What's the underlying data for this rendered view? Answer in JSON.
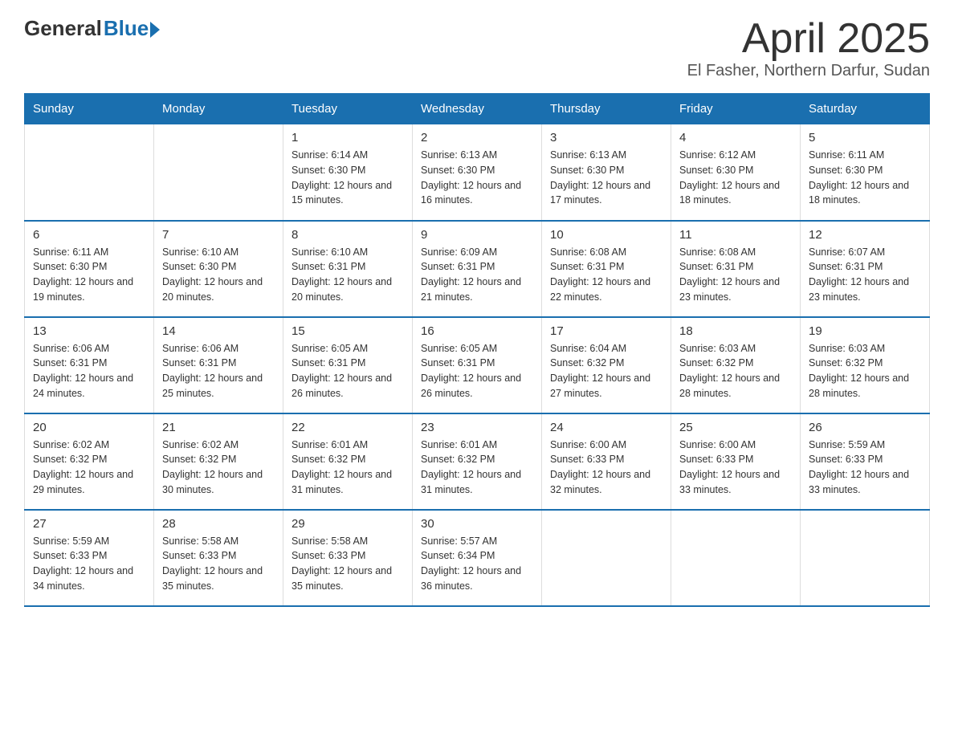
{
  "logo": {
    "general": "General",
    "blue": "Blue"
  },
  "title": "April 2025",
  "subtitle": "El Fasher, Northern Darfur, Sudan",
  "days_of_week": [
    "Sunday",
    "Monday",
    "Tuesday",
    "Wednesday",
    "Thursday",
    "Friday",
    "Saturday"
  ],
  "weeks": [
    [
      {
        "day": "",
        "sunrise": "",
        "sunset": "",
        "daylight": ""
      },
      {
        "day": "",
        "sunrise": "",
        "sunset": "",
        "daylight": ""
      },
      {
        "day": "1",
        "sunrise": "Sunrise: 6:14 AM",
        "sunset": "Sunset: 6:30 PM",
        "daylight": "Daylight: 12 hours and 15 minutes."
      },
      {
        "day": "2",
        "sunrise": "Sunrise: 6:13 AM",
        "sunset": "Sunset: 6:30 PM",
        "daylight": "Daylight: 12 hours and 16 minutes."
      },
      {
        "day": "3",
        "sunrise": "Sunrise: 6:13 AM",
        "sunset": "Sunset: 6:30 PM",
        "daylight": "Daylight: 12 hours and 17 minutes."
      },
      {
        "day": "4",
        "sunrise": "Sunrise: 6:12 AM",
        "sunset": "Sunset: 6:30 PM",
        "daylight": "Daylight: 12 hours and 18 minutes."
      },
      {
        "day": "5",
        "sunrise": "Sunrise: 6:11 AM",
        "sunset": "Sunset: 6:30 PM",
        "daylight": "Daylight: 12 hours and 18 minutes."
      }
    ],
    [
      {
        "day": "6",
        "sunrise": "Sunrise: 6:11 AM",
        "sunset": "Sunset: 6:30 PM",
        "daylight": "Daylight: 12 hours and 19 minutes."
      },
      {
        "day": "7",
        "sunrise": "Sunrise: 6:10 AM",
        "sunset": "Sunset: 6:30 PM",
        "daylight": "Daylight: 12 hours and 20 minutes."
      },
      {
        "day": "8",
        "sunrise": "Sunrise: 6:10 AM",
        "sunset": "Sunset: 6:31 PM",
        "daylight": "Daylight: 12 hours and 20 minutes."
      },
      {
        "day": "9",
        "sunrise": "Sunrise: 6:09 AM",
        "sunset": "Sunset: 6:31 PM",
        "daylight": "Daylight: 12 hours and 21 minutes."
      },
      {
        "day": "10",
        "sunrise": "Sunrise: 6:08 AM",
        "sunset": "Sunset: 6:31 PM",
        "daylight": "Daylight: 12 hours and 22 minutes."
      },
      {
        "day": "11",
        "sunrise": "Sunrise: 6:08 AM",
        "sunset": "Sunset: 6:31 PM",
        "daylight": "Daylight: 12 hours and 23 minutes."
      },
      {
        "day": "12",
        "sunrise": "Sunrise: 6:07 AM",
        "sunset": "Sunset: 6:31 PM",
        "daylight": "Daylight: 12 hours and 23 minutes."
      }
    ],
    [
      {
        "day": "13",
        "sunrise": "Sunrise: 6:06 AM",
        "sunset": "Sunset: 6:31 PM",
        "daylight": "Daylight: 12 hours and 24 minutes."
      },
      {
        "day": "14",
        "sunrise": "Sunrise: 6:06 AM",
        "sunset": "Sunset: 6:31 PM",
        "daylight": "Daylight: 12 hours and 25 minutes."
      },
      {
        "day": "15",
        "sunrise": "Sunrise: 6:05 AM",
        "sunset": "Sunset: 6:31 PM",
        "daylight": "Daylight: 12 hours and 26 minutes."
      },
      {
        "day": "16",
        "sunrise": "Sunrise: 6:05 AM",
        "sunset": "Sunset: 6:31 PM",
        "daylight": "Daylight: 12 hours and 26 minutes."
      },
      {
        "day": "17",
        "sunrise": "Sunrise: 6:04 AM",
        "sunset": "Sunset: 6:32 PM",
        "daylight": "Daylight: 12 hours and 27 minutes."
      },
      {
        "day": "18",
        "sunrise": "Sunrise: 6:03 AM",
        "sunset": "Sunset: 6:32 PM",
        "daylight": "Daylight: 12 hours and 28 minutes."
      },
      {
        "day": "19",
        "sunrise": "Sunrise: 6:03 AM",
        "sunset": "Sunset: 6:32 PM",
        "daylight": "Daylight: 12 hours and 28 minutes."
      }
    ],
    [
      {
        "day": "20",
        "sunrise": "Sunrise: 6:02 AM",
        "sunset": "Sunset: 6:32 PM",
        "daylight": "Daylight: 12 hours and 29 minutes."
      },
      {
        "day": "21",
        "sunrise": "Sunrise: 6:02 AM",
        "sunset": "Sunset: 6:32 PM",
        "daylight": "Daylight: 12 hours and 30 minutes."
      },
      {
        "day": "22",
        "sunrise": "Sunrise: 6:01 AM",
        "sunset": "Sunset: 6:32 PM",
        "daylight": "Daylight: 12 hours and 31 minutes."
      },
      {
        "day": "23",
        "sunrise": "Sunrise: 6:01 AM",
        "sunset": "Sunset: 6:32 PM",
        "daylight": "Daylight: 12 hours and 31 minutes."
      },
      {
        "day": "24",
        "sunrise": "Sunrise: 6:00 AM",
        "sunset": "Sunset: 6:33 PM",
        "daylight": "Daylight: 12 hours and 32 minutes."
      },
      {
        "day": "25",
        "sunrise": "Sunrise: 6:00 AM",
        "sunset": "Sunset: 6:33 PM",
        "daylight": "Daylight: 12 hours and 33 minutes."
      },
      {
        "day": "26",
        "sunrise": "Sunrise: 5:59 AM",
        "sunset": "Sunset: 6:33 PM",
        "daylight": "Daylight: 12 hours and 33 minutes."
      }
    ],
    [
      {
        "day": "27",
        "sunrise": "Sunrise: 5:59 AM",
        "sunset": "Sunset: 6:33 PM",
        "daylight": "Daylight: 12 hours and 34 minutes."
      },
      {
        "day": "28",
        "sunrise": "Sunrise: 5:58 AM",
        "sunset": "Sunset: 6:33 PM",
        "daylight": "Daylight: 12 hours and 35 minutes."
      },
      {
        "day": "29",
        "sunrise": "Sunrise: 5:58 AM",
        "sunset": "Sunset: 6:33 PM",
        "daylight": "Daylight: 12 hours and 35 minutes."
      },
      {
        "day": "30",
        "sunrise": "Sunrise: 5:57 AM",
        "sunset": "Sunset: 6:34 PM",
        "daylight": "Daylight: 12 hours and 36 minutes."
      },
      {
        "day": "",
        "sunrise": "",
        "sunset": "",
        "daylight": ""
      },
      {
        "day": "",
        "sunrise": "",
        "sunset": "",
        "daylight": ""
      },
      {
        "day": "",
        "sunrise": "",
        "sunset": "",
        "daylight": ""
      }
    ]
  ]
}
